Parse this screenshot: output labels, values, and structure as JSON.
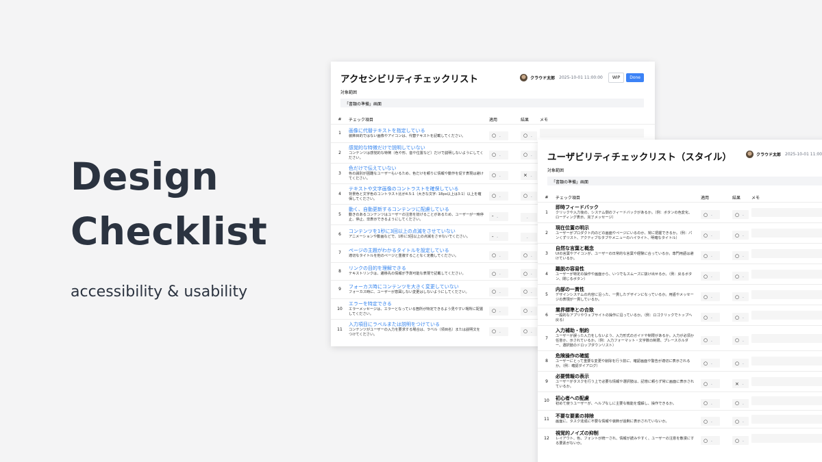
{
  "hero": {
    "line1": "Design",
    "line2": "Checklist",
    "subtitle": "accessibility & usability"
  },
  "common": {
    "author": "クラウド太郎",
    "timestamp": "2025-10-01 11:00:00",
    "badge_wip": "WIP",
    "badge_done": "Done",
    "scope_label": "対象範囲",
    "scope_value": "「書類の準備」画面",
    "col_num": "#",
    "col_item": "チェック項目",
    "col_apply": "適用",
    "col_result": "結果",
    "col_memo": "メモ",
    "chevron": "⌄"
  },
  "a11y": {
    "title": "アクセシビリティチェックリスト",
    "rows": [
      {
        "num": "1",
        "title": "画像に代替テキストを指定している",
        "desc": "装飾目的ではない画像やアイコンは、代替テキストを記載してください。",
        "apply": "○",
        "result": "○"
      },
      {
        "num": "2",
        "title": "感覚的な特徴だけで説明していない",
        "desc": "コンテンツは感覚的な特徴（色や形、音や位置など）だけで説明しないようにしてください。",
        "apply": "○",
        "result": "○"
      },
      {
        "num": "3",
        "title": "色だけで伝えていない",
        "desc": "色の識別が困難なユーザーもいるため、色だけを頼りに情報や動作を促す表現は避けてください。",
        "apply": "○",
        "result": "×"
      },
      {
        "num": "4",
        "title": "テキストや文字画像のコントラストを確保している",
        "desc": "背景色と文字色のコントラスト比が4.5:1（大きな文字: 18px以上は3:1）以上を確保してください。",
        "apply": "○",
        "result": "○"
      },
      {
        "num": "5",
        "title": "動く、自動更新するコンテンツに配慮している",
        "desc": "動きのあるコンテンツはユーザーの注意を妨げることがあるため、ユーザーが一時停止、停止、非表示できるようにしてください。",
        "apply": "-",
        "result": ""
      },
      {
        "num": "6",
        "title": "コンテンツを1秒に3回以上の点滅をさせていない",
        "desc": "アニメーションや動画などで、1秒に3回以上の点滅をさせないでください。",
        "apply": "-",
        "result": ""
      },
      {
        "num": "7",
        "title": "ページの主題がわかるタイトルを設定している",
        "desc": "適切なタイトルを他のページと重複することなく定義してください。",
        "apply": "○",
        "result": "○"
      },
      {
        "num": "8",
        "title": "リンクの目的を理解できる",
        "desc": "テキストリンクは、遷移先の情報が予測可能な表現で記載してください。",
        "apply": "○",
        "result": "○"
      },
      {
        "num": "9",
        "title": "フォーカス時にコンテンツを大きく変更していない",
        "desc": "フォーカス時に、ユーザーが意図しない変更はしないようにしてください。",
        "apply": "○",
        "result": "○"
      },
      {
        "num": "10",
        "title": "エラーを特定できる",
        "desc": "エラーメッセージは、エラーとなっている箇所が特定できるよう見やすい場所に配置してください。",
        "apply": "○",
        "result": "○"
      },
      {
        "num": "11",
        "title": "入力項目にラベルまたは説明をつけている",
        "desc": "コンテンツがユーザーの入力を要求する場合は、ラベル（項目名）または説明文をつけてください。",
        "apply": "○",
        "result": "○"
      }
    ]
  },
  "usability": {
    "title": "ユーザビリティチェックリスト（スタイル）",
    "rows": [
      {
        "num": "1",
        "title": "即時フィードバック",
        "desc": "クリックや入力後の、システム側のフィードバックがあるか。（例：ボタンの色変化、ローディング表示、完了メッセージ）",
        "apply": "○",
        "result": "○"
      },
      {
        "num": "2",
        "title": "現在位置の明示",
        "desc": "ユーザーがプロダクト内のどの画面やページにいるのか、常に把握できるか。（例：パンくずリスト、アクティブなタブやメニューのハイライト、明確なタイトル）",
        "apply": "○",
        "result": "○"
      },
      {
        "num": "3",
        "title": "自然な言葉と概念",
        "desc": "UIの言葉やアイコンが、ユーザーの日常的な言葉や経験に合っているか。専門用語は避けているか。",
        "apply": "○",
        "result": "○"
      },
      {
        "num": "4",
        "title": "離脱の容易性",
        "desc": "ユーザーが特定の操作や画面から、いつでもスムーズに抜け出せるか。（例：戻るボタン、閉じるボタン）",
        "apply": "○",
        "result": "○"
      },
      {
        "num": "5",
        "title": "内部の一貫性",
        "desc": "デザインシステムの内容に沿った、一貫したデザインになっているか。用語やメッセージの表現が一貫しているか。",
        "apply": "○",
        "result": "○"
      },
      {
        "num": "6",
        "title": "業界標準との合致",
        "desc": "一般的なアプリやウェブサイトの操作に沿っているか。（例：ロゴクリックでトップへ戻る）",
        "apply": "○",
        "result": "○"
      },
      {
        "num": "7",
        "title": "入力補助・制約",
        "desc": "ユーザーが誤った入力をしないよう、入力形式のガイドや制限があるか。入力が必須か任意か、示されているか。（例：入力フォーマット・文字数の制限、プレースホルダー、選択肢のドロップダウンリスト）",
        "apply": "○",
        "result": "○"
      },
      {
        "num": "8",
        "title": "危険操作の確認",
        "desc": "ユーザーにとって重要な変更や削除を行う前に、確認画面や警告が適切に表示されるか。（例：確認ダイアログ）",
        "apply": "○",
        "result": "○"
      },
      {
        "num": "9",
        "title": "必要情報の表示",
        "desc": "ユーザーがタスクを行う上で必要な情報や選択肢は、記憶に頼らず常に画面に表示されているか。",
        "apply": "○",
        "result": "×"
      },
      {
        "num": "10",
        "title": "初心者への配慮",
        "desc": "初めて使うユーザーが、ヘルプなしに主要な機能を理解し、操作できるか。",
        "apply": "○",
        "result": "○"
      },
      {
        "num": "11",
        "title": "不要な要素の排除",
        "desc": "画面に、タスク達成に不要な情報や装飾が過剰に表示されていないか。",
        "apply": "○",
        "result": "○"
      },
      {
        "num": "12",
        "title": "視覚的ノイズの抑制",
        "desc": "レイアウト、色、フォントが統一され、情報が読みやすく、ユーザーの注意を散漫にする要素がないか。",
        "apply": "○",
        "result": "○"
      }
    ]
  }
}
